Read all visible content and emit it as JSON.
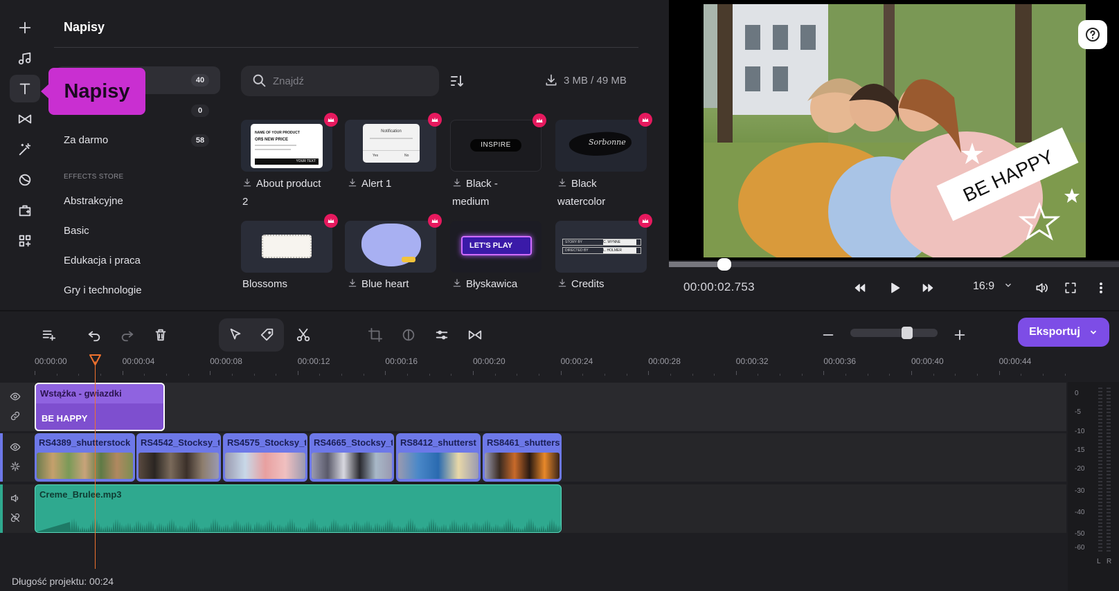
{
  "panel": {
    "title": "Napisy"
  },
  "tooltip": {
    "label": "Napisy"
  },
  "categories": [
    {
      "label": "",
      "count": "40"
    },
    {
      "label": "",
      "count": "0"
    },
    {
      "label": "Za darmo",
      "count": "58"
    }
  ],
  "store": {
    "heading": "EFFECTS STORE",
    "items": [
      "Abstrakcyjne",
      "Basic",
      "Edukacja i praca",
      "Gry i technologie"
    ]
  },
  "search": {
    "placeholder": "Znajdź",
    "value": ""
  },
  "storage": {
    "usage": "3 MB / 49 MB"
  },
  "templates": [
    {
      "label_line1": "About product",
      "label_line2": "2",
      "premium": true,
      "downloadable": true
    },
    {
      "label_line1": "Alert 1",
      "label_line2": "",
      "premium": true,
      "downloadable": true
    },
    {
      "label_line1": "Black -",
      "label_line2": "medium",
      "premium": true,
      "downloadable": true
    },
    {
      "label_line1": "Black",
      "label_line2": "watercolor",
      "premium": true,
      "downloadable": true
    },
    {
      "label_line1": "Blossoms",
      "label_line2": "",
      "premium": true,
      "downloadable": false
    },
    {
      "label_line1": "Blue heart",
      "label_line2": "",
      "premium": true,
      "downloadable": true
    },
    {
      "label_line1": "Błyskawica",
      "label_line2": "",
      "premium": false,
      "downloadable": true
    },
    {
      "label_line1": "Credits",
      "label_line2": "",
      "premium": true,
      "downloadable": true
    }
  ],
  "tile_text": {
    "product_heading": "NAME OF YOUR PRODUCT",
    "product_price": "OR$ NEW PRICE",
    "product_cta": "YOUR TEXT",
    "alert_title": "Notification",
    "alert_yes": "Yes",
    "alert_no": "No",
    "inspire": "INSPIRE",
    "watercolor": "Sorbonne",
    "lets_play": "LET'S PLAY",
    "credits_row1_label": "STORY BY",
    "credits_row1_value": "C. WYNNE",
    "credits_row2_label": "DIRECTED BY",
    "credits_row2_value": "L. HOLMER"
  },
  "preview": {
    "overlay_text": "BE HAPPY",
    "time": "00:00:02.753",
    "aspect": "16:9",
    "progress": 0.12
  },
  "toolbar": {
    "export_label": "Eksportuj",
    "zoom_level": 0.6
  },
  "ruler": [
    "00:00:00",
    "00:00:04",
    "00:00:08",
    "00:00:12",
    "00:00:16",
    "00:00:20",
    "00:00:24",
    "00:00:28",
    "00:00:32",
    "00:00:36",
    "00:00:40",
    "00:00:44"
  ],
  "timeline": {
    "text_clip": {
      "title": "Wstążka - gwiazdki",
      "text": "BE HAPPY"
    },
    "video_clips": [
      "RS4389_shutterstock",
      "RS4542_Stocksy_t",
      "RS4575_Stocksy_t",
      "RS4665_Stocksy_t",
      "RS8412_shutterst",
      "RS8461_shutterst"
    ],
    "audio_clip": {
      "title": "Creme_Brulee.mp3"
    },
    "project_length": "Długość projektu: 00:24"
  },
  "meter": {
    "labels": [
      "0",
      "-5",
      "-10",
      "-15",
      "-20",
      "-30",
      "-40",
      "-50",
      "-60"
    ],
    "left": "L",
    "right": "R"
  },
  "colors": {
    "accent": "#7d4de6",
    "tooltip": "#c92fd1",
    "playhead": "#f0722e",
    "text_clip": "#7e4fcf",
    "video_clip": "#6d78e8",
    "audio_clip": "#2fa98f",
    "premium_badge": "#e6195e"
  }
}
